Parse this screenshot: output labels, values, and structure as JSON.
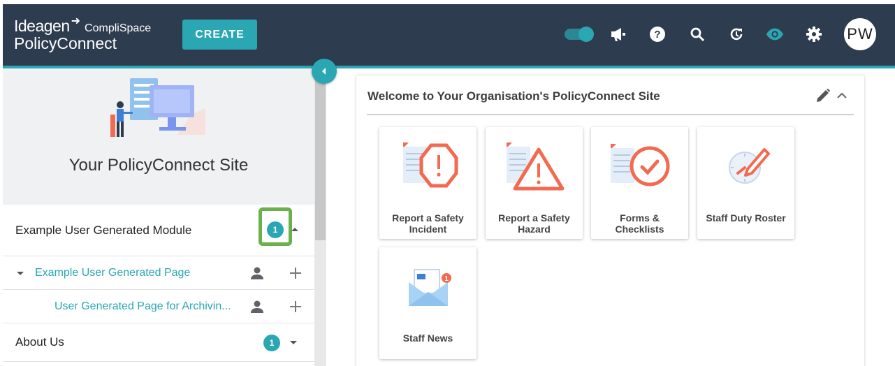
{
  "header": {
    "brand_ideagen": "Ideagen",
    "brand_complispace": "CompliSpace",
    "brand_product": "PolicyConnect",
    "create_label": "CREATE",
    "avatar_initials": "PW",
    "icons": [
      "toggle-switch",
      "megaphone-icon",
      "help-icon",
      "search-icon",
      "history-icon",
      "eye-icon",
      "gear-icon"
    ]
  },
  "sidebar": {
    "site_title": "Your PolicyConnect Site",
    "module": {
      "label": "Example User Generated Module",
      "badge": "1"
    },
    "page": {
      "label": "Example User Generated Page"
    },
    "subpage": {
      "label": "User Generated Page for Archivin..."
    },
    "about": {
      "label": "About Us",
      "badge": "1"
    }
  },
  "main": {
    "title": "Welcome to Your Organisation's PolicyConnect Site",
    "tiles": [
      {
        "label": "Report a Safety Incident",
        "icon": "incident-icon"
      },
      {
        "label": "Report a Safety Hazard",
        "icon": "hazard-icon"
      },
      {
        "label": "Forms & Checklists",
        "icon": "checklist-icon"
      },
      {
        "label": "Staff Duty Roster",
        "icon": "roster-icon"
      },
      {
        "label": "Staff News",
        "icon": "news-icon"
      }
    ]
  },
  "colors": {
    "header_bg": "#2e3c4f",
    "accent": "#2aa7b3",
    "highlight": "#6ab04c",
    "tile_orange": "#f26a4f"
  }
}
